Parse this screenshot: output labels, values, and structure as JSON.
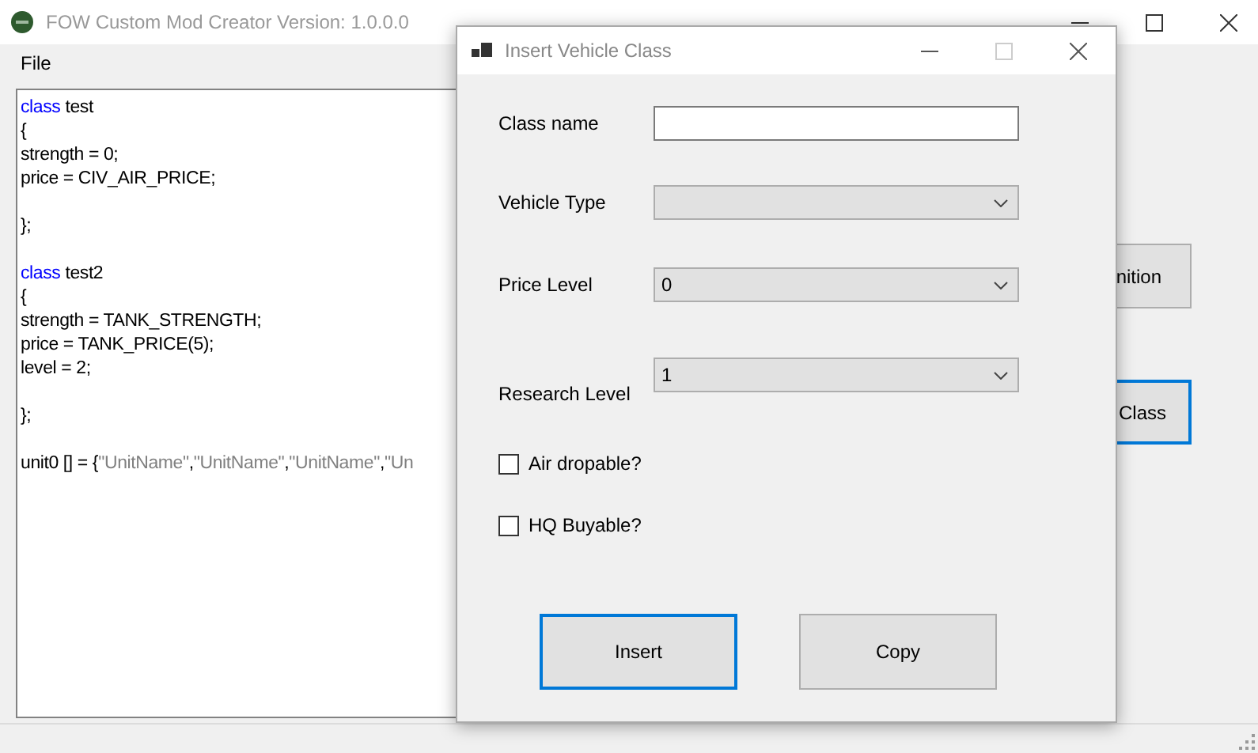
{
  "main_window": {
    "title": "FOW Custom Mod Creator Version: 1.0.0.0",
    "menu": [
      "File"
    ],
    "editor": {
      "blocks": [
        {
          "lines": [
            [
              {
                "kind": "keyword",
                "text": "class"
              },
              {
                "kind": "plain",
                "text": " test"
              }
            ],
            [
              {
                "kind": "plain",
                "text": "{"
              }
            ],
            [
              {
                "kind": "plain",
                "text": "strength = 0;"
              }
            ],
            [
              {
                "kind": "plain",
                "text": "price = CIV_AIR_PRICE;"
              }
            ]
          ]
        },
        {
          "lines": [
            [
              {
                "kind": "plain",
                "text": "};"
              }
            ]
          ]
        },
        {
          "lines": [
            [
              {
                "kind": "keyword",
                "text": "class"
              },
              {
                "kind": "plain",
                "text": " test2"
              }
            ],
            [
              {
                "kind": "plain",
                "text": "{"
              }
            ],
            [
              {
                "kind": "plain",
                "text": "strength = TANK_STRENGTH;"
              }
            ],
            [
              {
                "kind": "plain",
                "text": "price = TANK_PRICE(5);"
              }
            ],
            [
              {
                "kind": "plain",
                "text": "level = 2;"
              }
            ]
          ]
        },
        {
          "lines": [
            [
              {
                "kind": "plain",
                "text": "};"
              }
            ]
          ]
        },
        {
          "lines": [
            [
              {
                "kind": "plain",
                "text": "unit0 [] = {"
              },
              {
                "kind": "string",
                "text": "\"UnitName\""
              },
              {
                "kind": "plain",
                "text": ","
              },
              {
                "kind": "string",
                "text": "\"UnitName\""
              },
              {
                "kind": "plain",
                "text": ","
              },
              {
                "kind": "string",
                "text": "\"UnitName\""
              },
              {
                "kind": "plain",
                "text": ","
              },
              {
                "kind": "string",
                "text": "\"Un"
              }
            ]
          ]
        }
      ]
    },
    "buttons": [
      {
        "label": "nition",
        "focused": false
      },
      {
        "label": "Class",
        "focused": true
      }
    ]
  },
  "dialog": {
    "title": "Insert Vehicle Class",
    "fields": [
      {
        "kind": "text",
        "label": "Class name"
      },
      {
        "kind": "dropdown",
        "label": "Vehicle Type"
      },
      {
        "kind": "dropdown",
        "label": "Price Level",
        "value": "0"
      },
      {
        "kind": "dropdown",
        "label": "Research Level",
        "value": "1"
      }
    ],
    "checkboxes": [
      {
        "label": "Air dropable?",
        "checked": false
      },
      {
        "label": "HQ Buyable?",
        "checked": false
      }
    ],
    "buttons": [
      {
        "label": "Insert",
        "focused": true
      },
      {
        "label": "Copy",
        "focused": false
      }
    ]
  }
}
